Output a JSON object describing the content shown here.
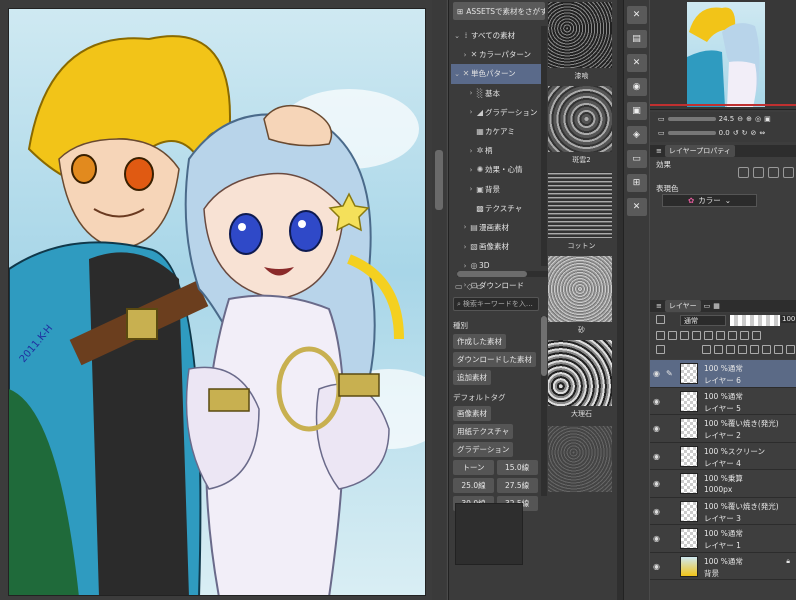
{
  "material": {
    "header": "ASSETSで素材をさがす",
    "tree": [
      {
        "label": "すべての素材",
        "icon": "grid-icon",
        "expanded": true,
        "selected": false
      },
      {
        "label": "カラーパターン",
        "icon": "pattern-icon",
        "expanded": false,
        "selected": false
      },
      {
        "label": "単色パターン",
        "icon": "pattern-icon",
        "expanded": true,
        "selected": true
      },
      {
        "label": "基本",
        "icon": "dots-icon",
        "expanded": false,
        "selected": false
      },
      {
        "label": "グラデーション",
        "icon": "gradient-icon",
        "expanded": false,
        "selected": false
      },
      {
        "label": "カケアミ",
        "icon": "crosshatch-icon",
        "expanded": false,
        "selected": false
      },
      {
        "label": "柄",
        "icon": "pattern-icon",
        "expanded": false,
        "selected": false
      },
      {
        "label": "効果・心情",
        "icon": "effect-icon",
        "expanded": false,
        "selected": false
      },
      {
        "label": "背景",
        "icon": "background-icon",
        "expanded": false,
        "selected": false
      },
      {
        "label": "テクスチャ",
        "icon": "texture-icon",
        "expanded": false,
        "selected": false
      },
      {
        "label": "漫画素材",
        "icon": "manga-icon",
        "expanded": false,
        "selected": false
      },
      {
        "label": "画像素材",
        "icon": "image-icon",
        "expanded": false,
        "selected": false
      },
      {
        "label": "3D",
        "icon": "3d-icon",
        "expanded": false,
        "selected": false
      },
      {
        "label": "ダウンロード",
        "icon": "download-icon",
        "expanded": false,
        "selected": false
      }
    ],
    "search_placeholder": "検索キーワードを入…",
    "tags": {
      "kind_heading": "種別",
      "kind": [
        "作成した素材",
        "ダウンロードした素材",
        "追加素材"
      ],
      "default_heading": "デフォルトタグ",
      "default": [
        "画像素材",
        "用紙テクスチャ",
        "グラデーション"
      ],
      "tone_pairs": [
        [
          "トーン",
          "15.0線"
        ],
        [
          "25.0線",
          "27.5線"
        ],
        [
          "30.0線",
          "32.5線"
        ]
      ]
    },
    "thumbnails": [
      {
        "label": "漆喰"
      },
      {
        "label": "斑雲2"
      },
      {
        "label": "コットン"
      },
      {
        "label": "砂"
      },
      {
        "label": "大理石"
      },
      {
        "label": ""
      }
    ]
  },
  "navigator": {
    "zoom": "24.5",
    "rotate": "0.0"
  },
  "property": {
    "tab_label": "レイヤープロパティ",
    "effect_label": "効果",
    "color_label": "表現色",
    "color_value": "カラー"
  },
  "layer_panel": {
    "tab_label": "レイヤー",
    "blend_mode": "通常",
    "opacity": "100",
    "layers": [
      {
        "line1": "100 %通常",
        "line2": "レイヤー 6",
        "selected": true,
        "editing": true,
        "locked": false
      },
      {
        "line1": "100 %通常",
        "line2": "レイヤー 5",
        "selected": false,
        "editing": false,
        "locked": false
      },
      {
        "line1": "100 %覆い焼き(発光)",
        "line2": "レイヤー 2",
        "selected": false,
        "editing": false,
        "locked": false
      },
      {
        "line1": "100 %スクリーン",
        "line2": "レイヤー 4",
        "selected": false,
        "editing": false,
        "locked": false
      },
      {
        "line1": "100 %乗算",
        "line2": "1000px",
        "selected": false,
        "editing": false,
        "locked": false
      },
      {
        "line1": "100 %覆い焼き(発光)",
        "line2": "レイヤー 3",
        "selected": false,
        "editing": false,
        "locked": false
      },
      {
        "line1": "100 %通常",
        "line2": "レイヤー 1",
        "selected": false,
        "editing": false,
        "locked": false
      },
      {
        "line1": "100 %通常",
        "line2": "背景",
        "selected": false,
        "editing": false,
        "locked": true
      }
    ]
  }
}
